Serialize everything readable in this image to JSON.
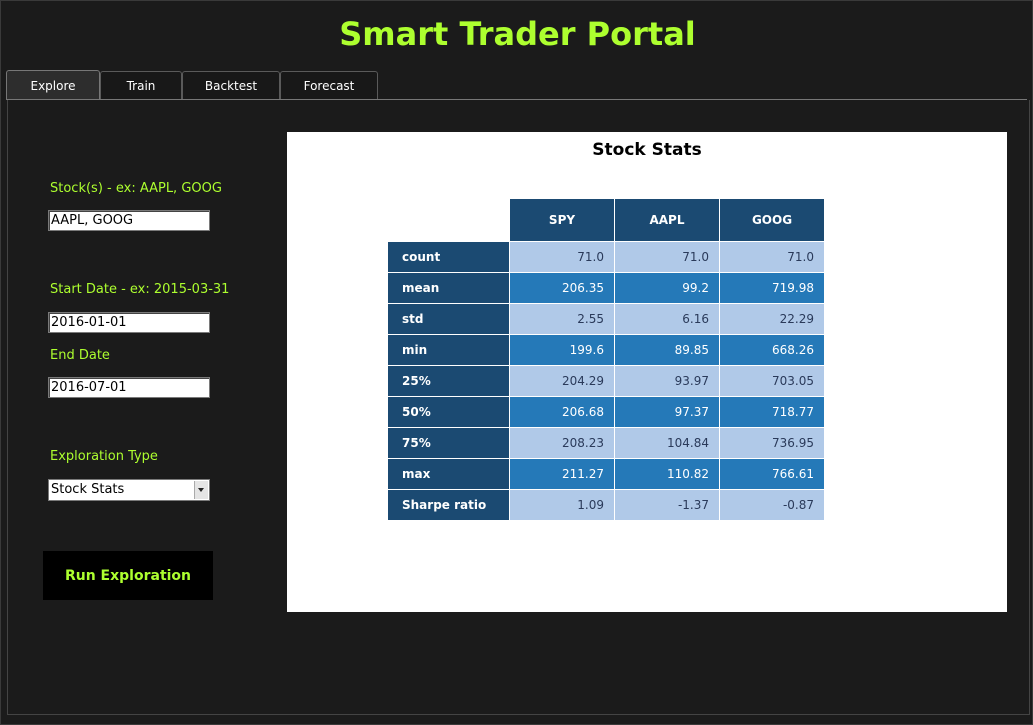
{
  "app": {
    "title": "Smart Trader Portal"
  },
  "tabs": [
    {
      "label": "Explore",
      "active": true
    },
    {
      "label": "Train",
      "active": false
    },
    {
      "label": "Backtest",
      "active": false
    },
    {
      "label": "Forecast",
      "active": false
    }
  ],
  "form": {
    "stocks_label": "Stock(s) - ex: AAPL, GOOG",
    "stocks_value": "AAPL, GOOG",
    "start_label": "Start Date - ex: 2015-03-31",
    "start_value": "2016-01-01",
    "end_label": "End Date",
    "end_value": "2016-07-01",
    "exploration_label": "Exploration Type",
    "exploration_value": "Stock Stats",
    "run_label": "Run Exploration"
  },
  "colors": {
    "accent": "#adff2f",
    "header_cell": "#1b4a72",
    "row_dark": "#2579b8",
    "row_light": "#b0c9e8"
  },
  "chart_data": {
    "type": "table",
    "title": "Stock Stats",
    "columns": [
      "SPY",
      "AAPL",
      "GOOG"
    ],
    "rows": [
      {
        "label": "count",
        "values": [
          "71.0",
          "71.0",
          "71.0"
        ]
      },
      {
        "label": "mean",
        "values": [
          "206.35",
          "99.2",
          "719.98"
        ]
      },
      {
        "label": "std",
        "values": [
          "2.55",
          "6.16",
          "22.29"
        ]
      },
      {
        "label": "min",
        "values": [
          "199.6",
          "89.85",
          "668.26"
        ]
      },
      {
        "label": "25%",
        "values": [
          "204.29",
          "93.97",
          "703.05"
        ]
      },
      {
        "label": "50%",
        "values": [
          "206.68",
          "97.37",
          "718.77"
        ]
      },
      {
        "label": "75%",
        "values": [
          "208.23",
          "104.84",
          "736.95"
        ]
      },
      {
        "label": "max",
        "values": [
          "211.27",
          "110.82",
          "766.61"
        ]
      },
      {
        "label": "Sharpe ratio",
        "values": [
          "1.09",
          "-1.37",
          "-0.87"
        ]
      }
    ]
  }
}
